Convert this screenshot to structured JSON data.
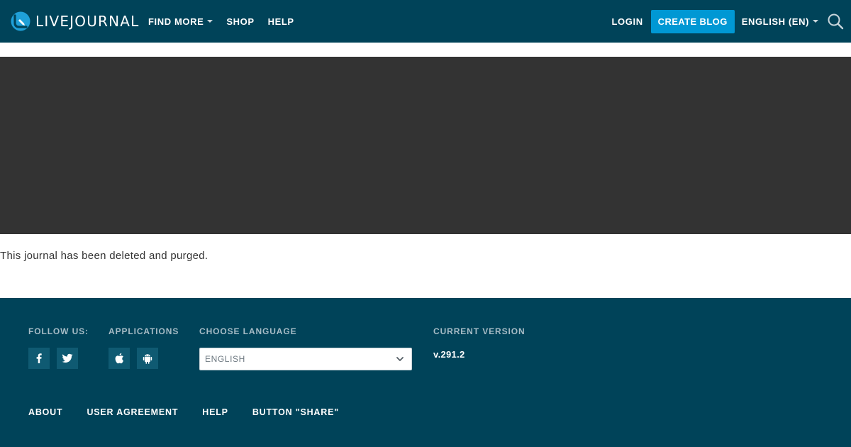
{
  "header": {
    "logo_text": "LIVEJOURNAL",
    "nav": [
      {
        "label": "FIND MORE",
        "has_dropdown": true
      },
      {
        "label": "SHOP",
        "has_dropdown": false
      },
      {
        "label": "HELP",
        "has_dropdown": false
      }
    ],
    "login_label": "LOGIN",
    "create_label": "CREATE BLOG",
    "language_label": "ENGLISH (EN)",
    "search_icon": "search-icon"
  },
  "main": {
    "message": "This journal has been deleted and purged."
  },
  "footer": {
    "follow_heading": "FOLLOW US:",
    "apps_heading": "APPLICATIONS",
    "language_heading": "CHOOSE LANGUAGE",
    "version_heading": "CURRENT VERSION",
    "language_value": "ENGLISH",
    "version": "v.291.2",
    "social_icons": [
      "facebook-icon",
      "twitter-icon"
    ],
    "app_icons": [
      "apple-icon",
      "android-icon"
    ],
    "links": [
      "ABOUT",
      "USER AGREEMENT",
      "HELP",
      "BUTTON \"SHARE\""
    ]
  },
  "colors": {
    "header_bg": "#004359",
    "banner_bg": "#333333",
    "accent": "#0098d4",
    "footer_bg": "#004359"
  }
}
